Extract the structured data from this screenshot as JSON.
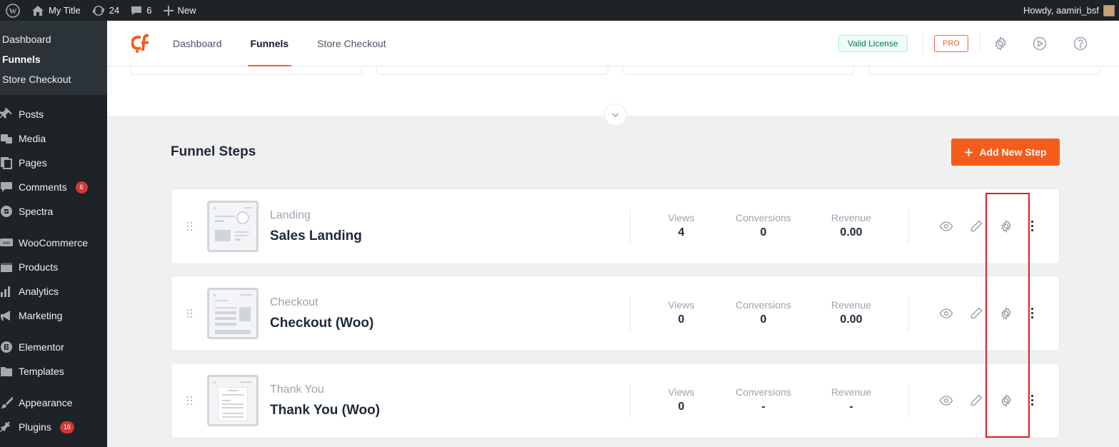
{
  "adminbar": {
    "site_title": "My Title",
    "updates_count": "24",
    "comments_count": "6",
    "new_label": "New",
    "howdy": "Howdy, aamiri_bsf"
  },
  "sidebar": {
    "submenu": [
      "Dashboard",
      "Funnels",
      "Store Checkout"
    ],
    "items": [
      {
        "label": "Posts",
        "icon": "pin-icon"
      },
      {
        "label": "Media",
        "icon": "media-icon"
      },
      {
        "label": "Pages",
        "icon": "pages-icon"
      },
      {
        "label": "Comments",
        "icon": "comment-icon",
        "badge": "6"
      },
      {
        "label": "Spectra",
        "icon": "spectra-icon"
      },
      {
        "label": "WooCommerce",
        "icon": "woo-icon"
      },
      {
        "label": "Products",
        "icon": "products-icon"
      },
      {
        "label": "Analytics",
        "icon": "analytics-icon"
      },
      {
        "label": "Marketing",
        "icon": "megaphone-icon"
      },
      {
        "label": "Elementor",
        "icon": "elementor-icon"
      },
      {
        "label": "Templates",
        "icon": "folder-icon"
      },
      {
        "label": "Appearance",
        "icon": "brush-icon"
      },
      {
        "label": "Plugins",
        "icon": "plug-icon",
        "badge": "16"
      }
    ]
  },
  "header": {
    "tabs": [
      "Dashboard",
      "Funnels",
      "Store Checkout"
    ],
    "active_tab": "Funnels",
    "license": "Valid License",
    "pro": "PRO"
  },
  "funnel_steps": {
    "title": "Funnel Steps",
    "add_button": "Add New Step",
    "metric_labels": {
      "views": "Views",
      "conversions": "Conversions",
      "revenue": "Revenue"
    },
    "steps": [
      {
        "type": "Landing",
        "name": "Sales Landing",
        "views": "4",
        "conversions": "0",
        "revenue": "0.00"
      },
      {
        "type": "Checkout",
        "name": "Checkout (Woo)",
        "views": "0",
        "conversions": "0",
        "revenue": "0.00"
      },
      {
        "type": "Thank You",
        "name": "Thank You (Woo)",
        "views": "0",
        "conversions": "-",
        "revenue": "-"
      }
    ]
  },
  "colors": {
    "accent": "#f55b1a",
    "admin_dark": "#1d2327",
    "highlight": "#e11d2a"
  }
}
